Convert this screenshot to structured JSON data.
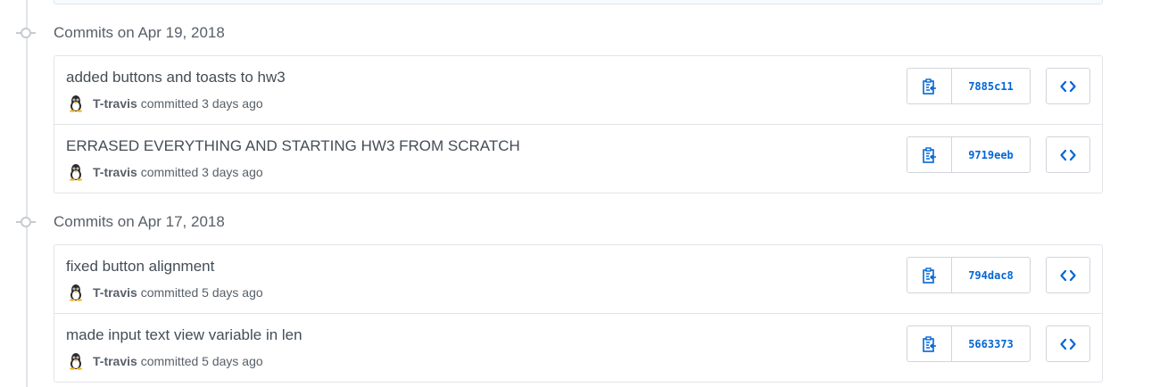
{
  "groups": [
    {
      "title": "Commits on Apr 19, 2018",
      "commits": [
        {
          "message": "added buttons and toasts to hw3",
          "author": "T-travis",
          "meta": "committed 3 days ago",
          "sha": "7885c11"
        },
        {
          "message": "ERRASED EVERYTHING AND STARTING HW3 FROM SCRATCH",
          "author": "T-travis",
          "meta": "committed 3 days ago",
          "sha": "9719eeb"
        }
      ]
    },
    {
      "title": "Commits on Apr 17, 2018",
      "commits": [
        {
          "message": "fixed button alignment",
          "author": "T-travis",
          "meta": "committed 5 days ago",
          "sha": "794dac8"
        },
        {
          "message": "made input text view variable in len",
          "author": "T-travis",
          "meta": "committed 5 days ago",
          "sha": "5663373"
        }
      ]
    }
  ],
  "icons": {
    "copy": "clippy-icon",
    "browse": "code-icon",
    "avatar": "tux-penguin-avatar"
  },
  "colors": {
    "link": "#0366d6",
    "border": "#e1e4e8",
    "muted_text": "#586069",
    "title_text": "#444d56"
  }
}
